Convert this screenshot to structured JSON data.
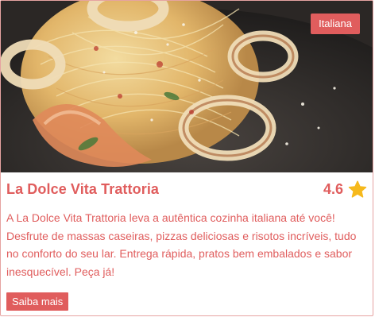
{
  "card": {
    "category_tag": "Italiana",
    "title": "La Dolce Vita Trattoria",
    "rating": "4.6",
    "description": "A La Dolce Vita Trattoria leva a autêntica cozinha italiana até você! Desfrute de massas caseiras, pizzas deliciosas e risotos incríveis, tudo no conforto do seu lar. Entrega rápida, pratos bem embalados e sabor inesquecível. Peça já!",
    "cta_label": "Saiba mais"
  },
  "colors": {
    "accent": "#e05d5d",
    "star": "#f6b91c",
    "border": "#e6a3a1"
  },
  "icons": {
    "rating": "star-icon"
  }
}
